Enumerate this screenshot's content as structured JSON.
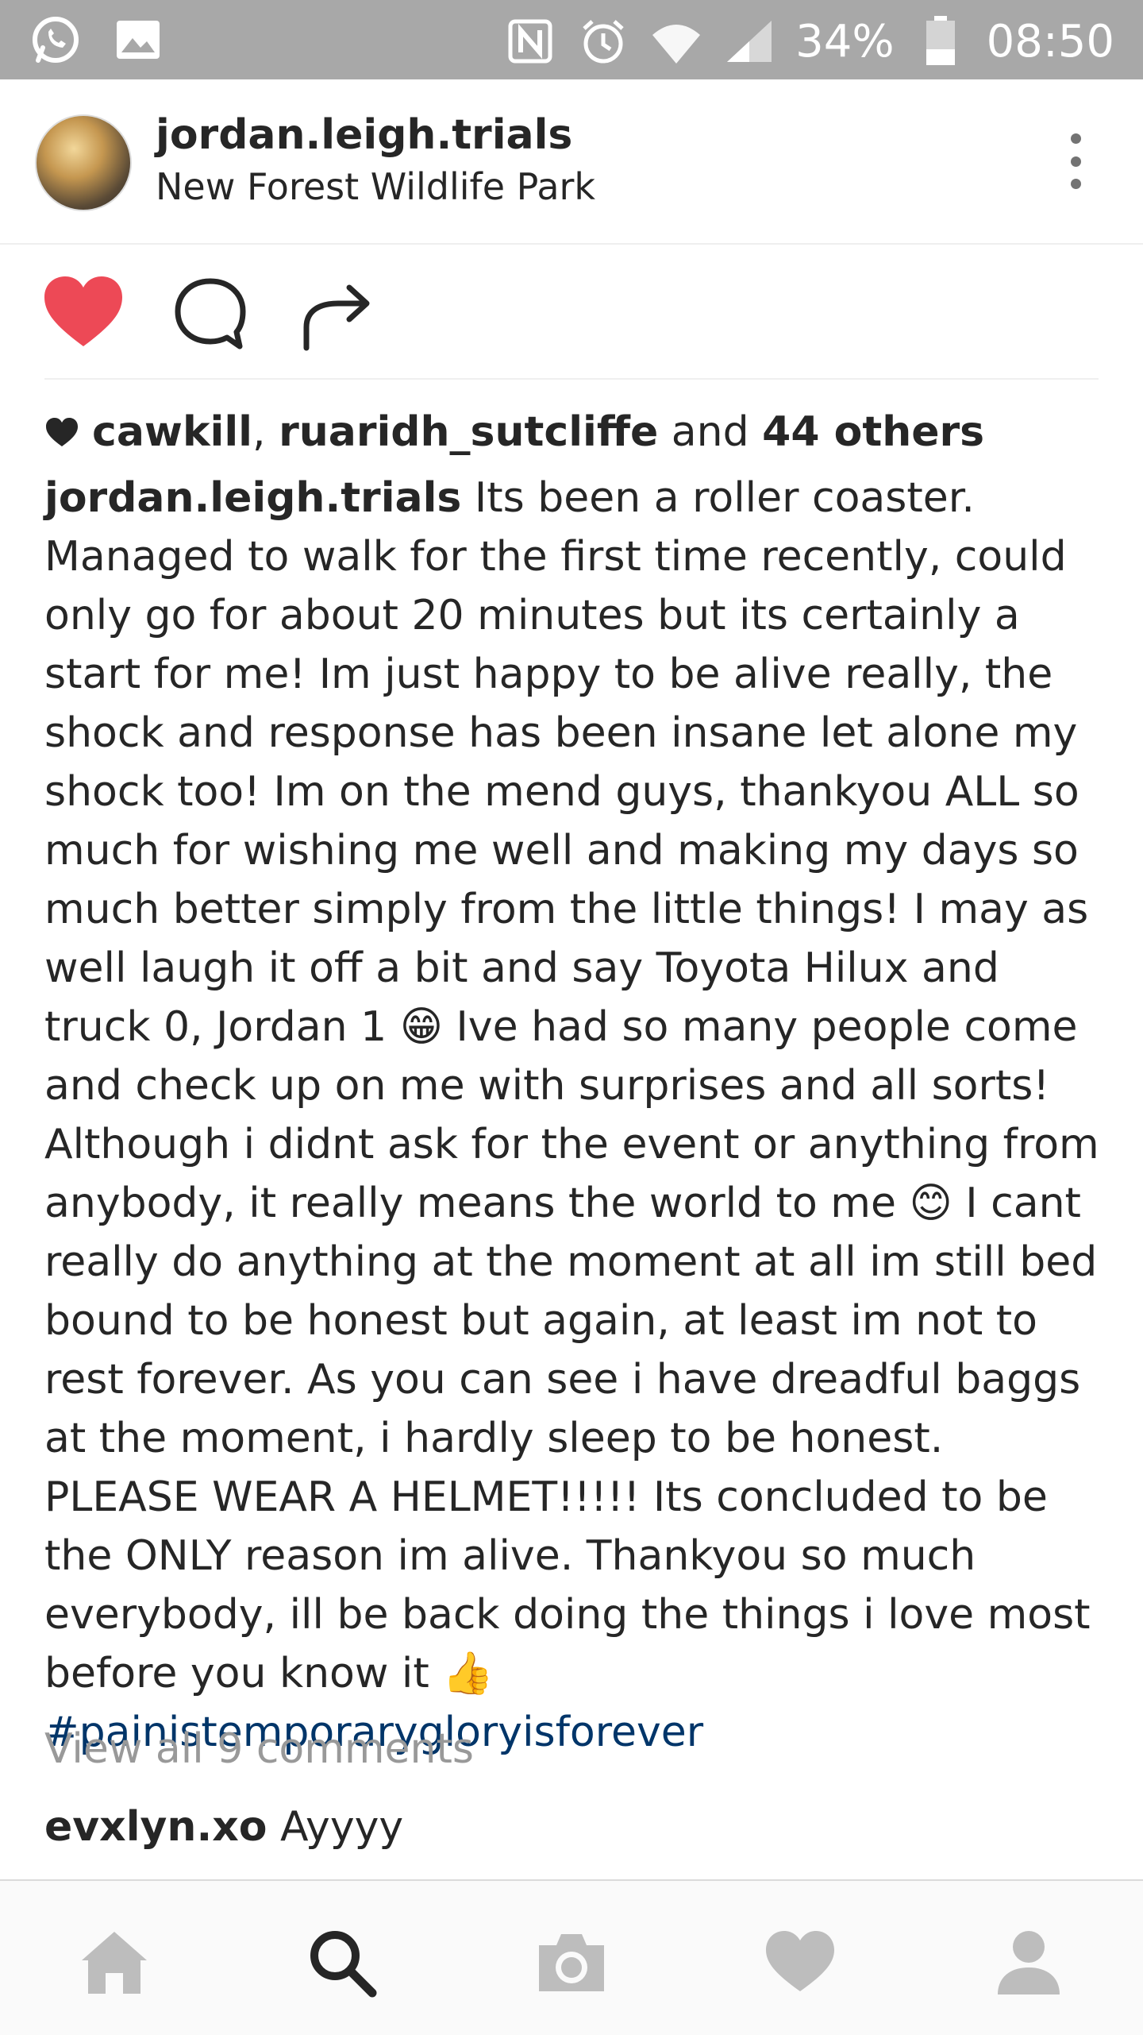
{
  "status_bar": {
    "battery": "34%",
    "time": "08:50",
    "icons": [
      "whatsapp-icon",
      "image-icon",
      "nfc-icon",
      "alarm-icon",
      "wifi-icon",
      "signal-icon",
      "battery-icon"
    ]
  },
  "post": {
    "username": "jordan.leigh.trials",
    "location": "New Forest Wildlife Park",
    "liked": true,
    "likes": {
      "user1": "cawkill",
      "separator": ",",
      "user2": "ruaridh_sutcliffe",
      "and_text": "and",
      "others": "44 others"
    },
    "caption": {
      "username": "jordan.leigh.trials",
      "part1": "Its been a roller coaster. Managed to walk for the first time recently, could only go for about 20 minutes but its certainly a start for me! Im just happy to be alive really, the shock and response has been insane let alone my shock too! Im on the mend guys, thankyou ALL so much for wishing me well and making my days so much better simply from the little things! I may as well laugh it off a bit and say Toyota Hilux and truck 0, Jordan 1",
      "emoji1": "😁",
      "part2": "Ive had so many people come and check up on me with surprises and all sorts! Although i didnt ask for the event or anything from anybody, it really means the world to me",
      "emoji2": "😊",
      "part3": "I cant really do anything at the moment at all im still bed bound to be honest but again, at least im not to rest forever. As you can see i have dreadful baggs at the moment, i hardly sleep to be honest. PLEASE WEAR A HELMET!!!!! Its concluded to be the ONLY reason im alive. Thankyou so much everybody, ill be back doing the things i love most before you know it",
      "emoji3": "👍",
      "hashtag": "#painistemporarygloryisforever"
    },
    "view_comments": "View all 9 comments",
    "comment": {
      "username": "evxlyn.xo",
      "text": "Ayyyy"
    }
  },
  "colors": {
    "heart": "#ed4956",
    "hashtag": "#003569",
    "muted": "#999999",
    "status_bar": "#a8a8a8"
  },
  "bottom_nav": [
    "home-icon",
    "search-icon",
    "camera-icon",
    "activity-heart-icon",
    "profile-icon"
  ]
}
